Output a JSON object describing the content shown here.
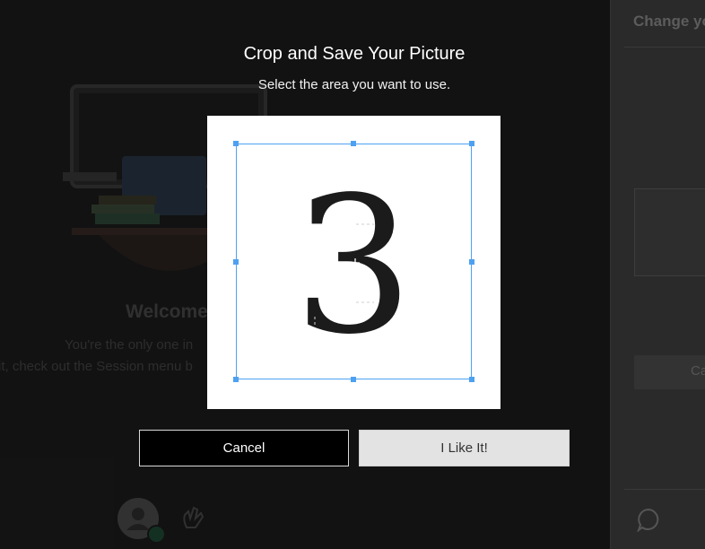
{
  "dialog": {
    "title": "Crop and Save Your Picture",
    "subtitle": "Select the area you want to use.",
    "image_glyph": "3",
    "cancel_label": "Cancel",
    "confirm_label": "I Like It!"
  },
  "background": {
    "welcome_title": "Welcome",
    "welcome_line1": "You're the only one in",
    "welcome_line2": "it, check out the Session menu b",
    "panel_title": "Change yo",
    "panel_button_label": "Ca"
  },
  "colors": {
    "crop_accent": "#4ea1f1",
    "dialog_bg": "#000000",
    "confirm_bg": "#e3e3e3"
  },
  "icons": [
    "laptop-illustration",
    "avatar-icon",
    "check-badge-icon",
    "raise-hand-icon",
    "chat-icon",
    "crosshair-icon"
  ]
}
